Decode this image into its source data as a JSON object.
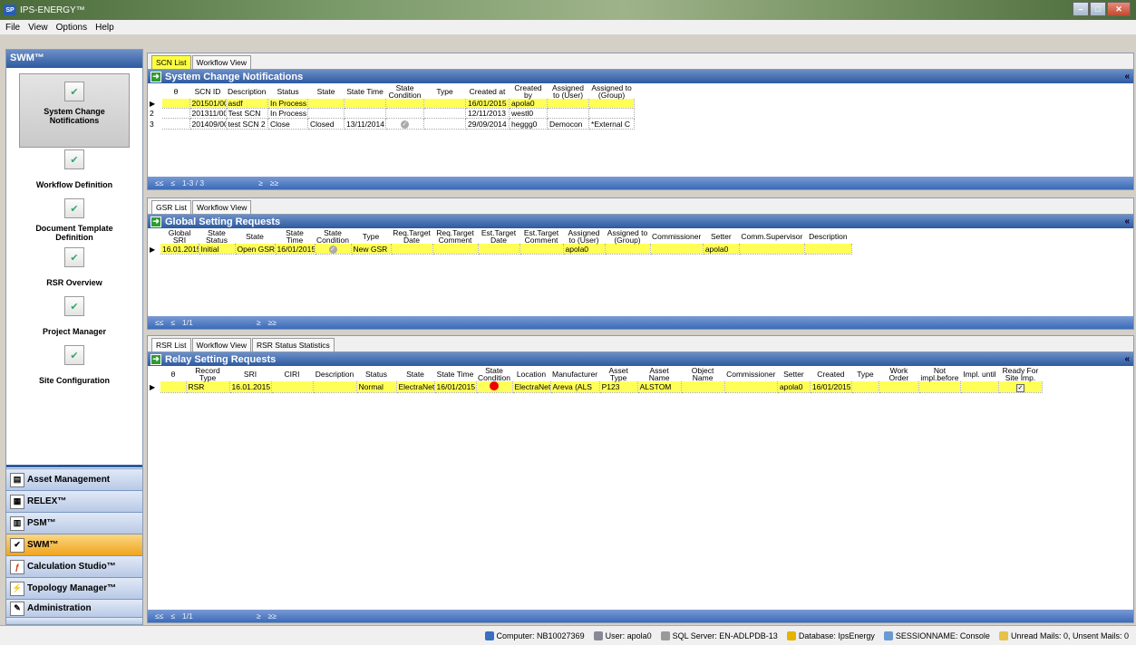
{
  "window": {
    "title": "IPS-ENERGY™",
    "app_icon": "ips"
  },
  "menu": [
    "File",
    "View",
    "Options",
    "Help"
  ],
  "sidebar": {
    "title": "SWM™",
    "items": [
      {
        "label": "System Change Notifications",
        "active": true
      },
      {
        "label": "Workflow Definition"
      },
      {
        "label": "Document Template Definition"
      },
      {
        "label": "RSR Overview"
      },
      {
        "label": "Project Manager"
      },
      {
        "label": "Site Configuration"
      }
    ],
    "modules": [
      {
        "label": "Asset Management"
      },
      {
        "label": "RELEX™"
      },
      {
        "label": "PSM™"
      },
      {
        "label": "SWM™",
        "active": true
      },
      {
        "label": "Calculation Studio™"
      },
      {
        "label": "Topology Manager™"
      },
      {
        "label": "Administration"
      }
    ],
    "splitter_dots": "·········",
    "expand": "»"
  },
  "scn": {
    "tabs": [
      "SCN List",
      "Workflow View"
    ],
    "title": "System Change Notifications",
    "columns": [
      "θ",
      "SCN ID",
      "Description",
      "Status",
      "State",
      "State Time",
      "State Condition",
      "Type",
      "Created at",
      "Created by",
      "Assigned to (User)",
      "Assigned to (Group)"
    ],
    "rows": [
      {
        "num": "",
        "cells": [
          "",
          "201501/00",
          "asdf",
          "In Process",
          "",
          "",
          "",
          "",
          "16/01/2015",
          "apola0",
          "",
          ""
        ]
      },
      {
        "num": "2",
        "cells": [
          "",
          "201311/00",
          "Test SCN",
          "In Process",
          "",
          "",
          "",
          "",
          "12/11/2013",
          "westl0",
          "",
          ""
        ]
      },
      {
        "num": "3",
        "cells": [
          "",
          "201409/00",
          "test SCN 2",
          "Close",
          "Closed",
          "13/11/2014",
          "check",
          "",
          "29/09/2014",
          "heggg0",
          "Democon",
          "*External C"
        ]
      }
    ],
    "footer": [
      "≤≤",
      "≤",
      "1-3 / 3",
      "≥",
      "≥≥"
    ]
  },
  "gsr": {
    "tabs": [
      "GSR List",
      "Workflow View"
    ],
    "title": "Global Setting Requests",
    "columns": [
      "Global SRI",
      "State Status",
      "State",
      "State Time",
      "State Condition",
      "Type",
      "Req.Target Date",
      "Req.Target Comment",
      "Est.Target Date",
      "Est.Target Comment",
      "Assigned to (User)",
      "Assigned to (Group)",
      "Commissioner",
      "Setter",
      "Comm.Supervisor",
      "Description"
    ],
    "rows": [
      {
        "cells": [
          "16.01.2015",
          "Initial",
          "Open GSR",
          "16/01/2015",
          "check",
          "New GSR",
          "",
          "",
          "",
          "",
          "apola0",
          "",
          "",
          "apola0",
          "",
          ""
        ]
      }
    ],
    "footer": [
      "≤≤",
      "≤",
      "1/1",
      "≥",
      "≥≥"
    ]
  },
  "rsr": {
    "tabs": [
      "RSR List",
      "Workflow View",
      "RSR Status Statistics"
    ],
    "title": "Relay Setting Requests",
    "columns": [
      "θ",
      "Record Type",
      "SRI",
      "CIRI",
      "Description",
      "Status",
      "State",
      "State Time",
      "State Condition",
      "Location",
      "Manufacturer",
      "Asset Type",
      "Asset Name",
      "Object Name",
      "Commissioner",
      "Setter",
      "Created",
      "Type",
      "Work Order",
      "Not impl.before",
      "Impl. until",
      "Ready For Site Imp."
    ],
    "rows": [
      {
        "cells": [
          "",
          "RSR",
          "16.01.2015",
          "",
          "",
          "Normal",
          "ElectraNet",
          "16/01/2015",
          "red",
          "ElectraNet/",
          "Areva (ALS",
          "P123",
          "ALSTOM",
          "",
          "",
          "apola0",
          "16/01/2015",
          "",
          "",
          "",
          "",
          "checkbox"
        ]
      }
    ],
    "footer": [
      "≤≤",
      "≤",
      "1/1",
      "≥",
      "≥≥"
    ]
  },
  "status": {
    "computer": "Computer: NB10027369",
    "user": "User: apola0",
    "sql": "SQL Server: EN-ADLPDB-13",
    "database": "Database: IpsEnergy",
    "session": "SESSIONNAME: Console",
    "mails": "Unread Mails: 0, Unsent Mails: 0"
  },
  "colors": {
    "header_blue": "#2d5aa0",
    "highlight": "#ffff57",
    "active_module": "#f0a51f"
  }
}
